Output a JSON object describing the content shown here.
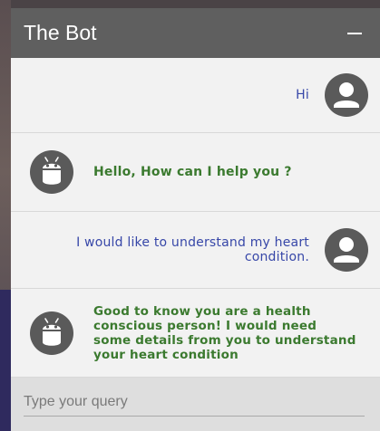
{
  "header": {
    "title": "The Bot"
  },
  "messages": [
    {
      "sender": "user",
      "text": "Hi",
      "avatar_icon": "user-avatar-icon"
    },
    {
      "sender": "bot",
      "text": "Hello, How can I help you ?",
      "avatar_icon": "android-robot-icon"
    },
    {
      "sender": "user",
      "text": "I would like to understand my heart condition.",
      "avatar_icon": "user-avatar-icon"
    },
    {
      "sender": "bot",
      "text": "Good to know you are a health conscious person! I would need some details from you to understand your heart condition",
      "avatar_icon": "android-robot-icon"
    }
  ],
  "input": {
    "placeholder": "Type your query",
    "value": ""
  },
  "colors": {
    "header_bg": "#5f5f5f",
    "user_text": "#3747a8",
    "bot_text": "#3b7a2f",
    "avatar": "#5a5a5a"
  }
}
